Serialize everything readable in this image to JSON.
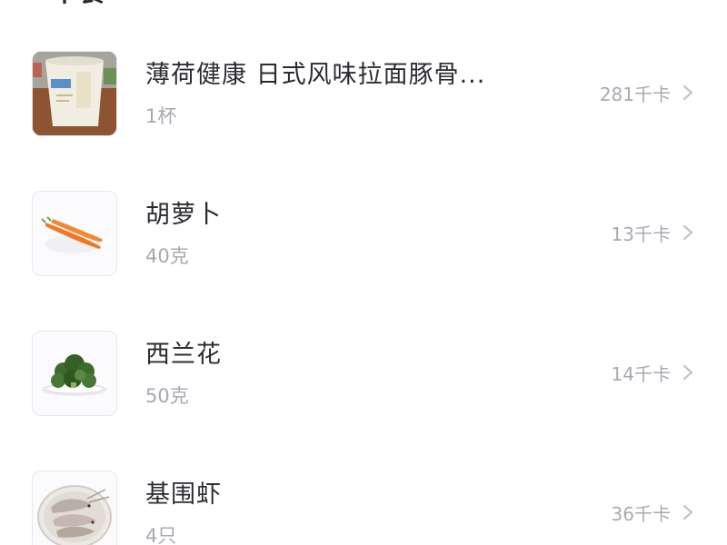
{
  "section": {
    "title": "午餐"
  },
  "items": [
    {
      "name": "薄荷健康 日式风味拉面豚骨...",
      "qty": "1杯",
      "kcal": "281千卡",
      "icon": "instant-noodle-cup-image"
    },
    {
      "name": "胡萝卜",
      "qty": "40克",
      "kcal": "13千卡",
      "icon": "carrot-image"
    },
    {
      "name": "西兰花",
      "qty": "50克",
      "kcal": "14千卡",
      "icon": "broccoli-image"
    },
    {
      "name": "基围虾",
      "qty": "4只",
      "kcal": "36千卡",
      "icon": "shrimp-image"
    }
  ],
  "colors": {
    "primary_text": "#2b2b33",
    "secondary_text": "#a8a8b3",
    "chevron": "#c4c4cc"
  }
}
